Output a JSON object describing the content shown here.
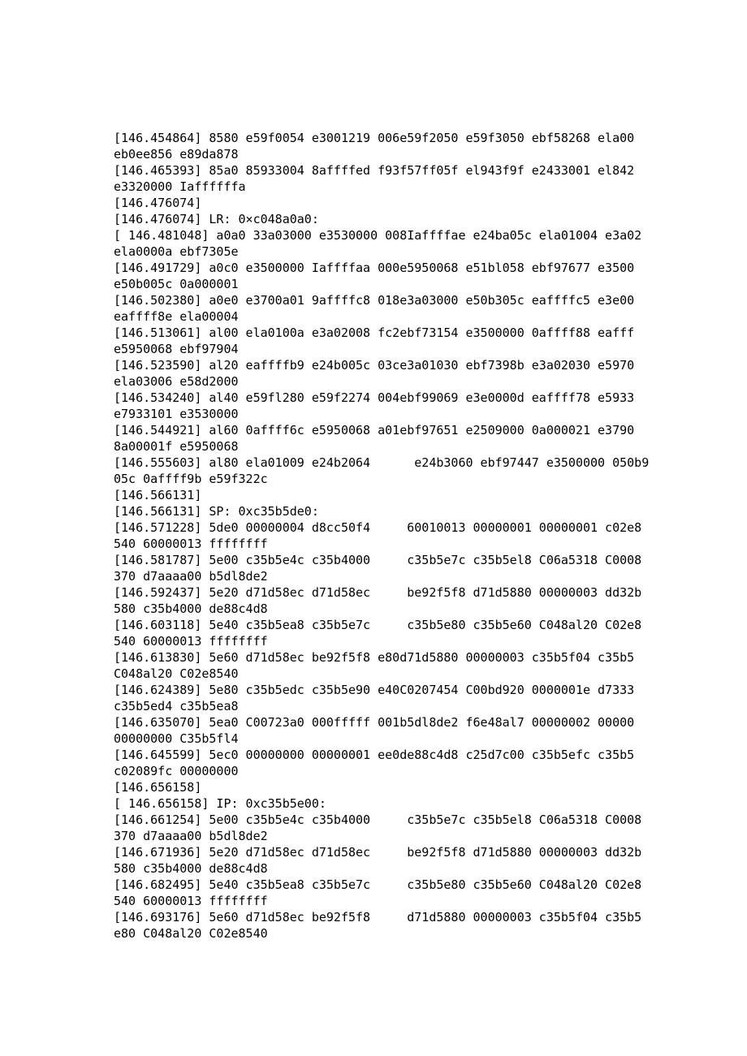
{
  "log": {
    "lines": [
      "[146.454864] 8580 e59f0054 e3001219 006e59f2050 e59f3050 ebf58268 ela00 eb0ee856 e89da878",
      "[146.465393] 85a0 85933004 8affffed f93f57ff05f el943f9f e2433001 el842 e3320000 Iaffffffa",
      "[146.476074]",
      "[146.476074] LR: 0×c048a0a0:",
      "[ 146.481048] a0a0 33a03000 e3530000 008Iaffffae e24ba05c ela01004 e3a02 ela0000a ebf7305e",
      "[146.491729] a0c0 e3500000 Iaffffaa 000e5950068 e51bl058 ebf97677 e3500 e50b005c 0a000001",
      "[146.502380] a0e0 e3700a01 9affffc8 018e3a03000 e50b305c eaffffc5 e3e00 eaffff8e ela00004",
      "[146.513061] al00 ela0100a e3a02008 fc2ebf73154 e3500000 0affff88 eafff e5950068 ebf97904",
      "[146.523590] al20 eaffffb9 e24b005c 03ce3a01030 ebf7398b e3a02030 e5970 ela03006 e58d2000",
      "[146.534240] al40 e59fl280 e59f2274 004ebf99069 e3e0000d eaffff78 e5933 e7933101 e3530000",
      "[146.544921] al60 0affff6c e5950068 a01ebf97651 e2509000 0a000021 e3790 8a00001f e5950068",
      "[146.555603] al80 ela01009 e24b2064      e24b3060 ebf97447 e3500000 050b9 05c 0affff9b e59f322c",
      "[146.566131]",
      "[146.566131] SP: 0xc35b5de0:",
      "[146.571228] 5de0 00000004 d8cc50f4     60010013 00000001 00000001 c02e8 540 60000013 ffffffff",
      "[146.581787] 5e00 c35b5e4c c35b4000     c35b5e7c c35b5el8 C06a5318 C0008 370 d7aaaa00 b5dl8de2",
      "[146.592437] 5e20 d71d58ec d71d58ec     be92f5f8 d71d5880 00000003 dd32b 580 c35b4000 de88c4d8",
      "[146.603118] 5e40 c35b5ea8 c35b5e7c     c35b5e80 c35b5e60 C048al20 C02e8 540 60000013 ffffffff",
      "[146.613830] 5e60 d71d58ec be92f5f8 e80d71d5880 00000003 c35b5f04 c35b5 C048al20 C02e8540",
      "[146.624389] 5e80 c35b5edc c35b5e90 e40C0207454 C00bd920 0000001e d7333 c35b5ed4 c35b5ea8",
      "[146.635070] 5ea0 C00723a0 000fffff 001b5dl8de2 f6e48al7 00000002 00000 00000000 C35b5fl4",
      "[146.645599] 5ec0 00000000 00000001 ee0de88c4d8 c25d7c00 c35b5efc c35b5 c02089fc 00000000",
      "[146.656158]",
      "[ 146.656158] IP: 0xc35b5e00:",
      "[146.661254] 5e00 c35b5e4c c35b4000     c35b5e7c c35b5el8 C06a5318 C0008 370 d7aaaa00 b5dl8de2",
      "[146.671936] 5e20 d71d58ec d71d58ec     be92f5f8 d71d5880 00000003 dd32b 580 c35b4000 de88c4d8",
      "[146.682495] 5e40 c35b5ea8 c35b5e7c     c35b5e80 c35b5e60 C048al20 C02e8 540 60000013 ffffffff",
      "[146.693176] 5e60 d71d58ec be92f5f8     d71d5880 00000003 c35b5f04 c35b5 e80 C048al20 C02e8540"
    ]
  }
}
